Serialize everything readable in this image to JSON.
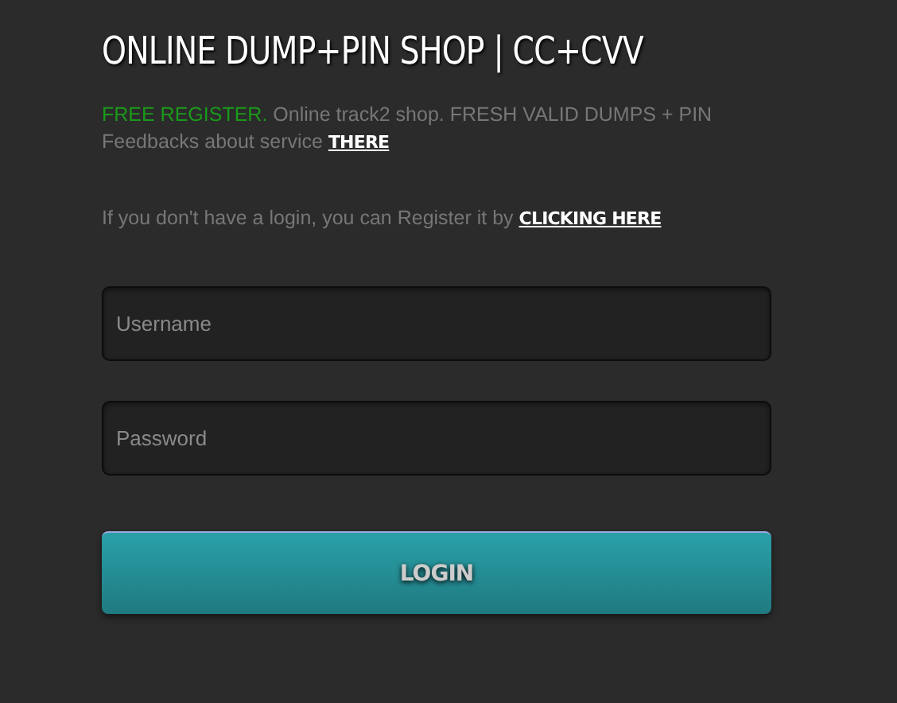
{
  "title": "ONLINE DUMP+PIN SHOP | CC+CVV",
  "intro": {
    "highlight": "FREE REGISTER.",
    "text": "Online track2 shop. FRESH VALID DUMPS + PIN",
    "feedback": "Feedbacks about service",
    "feedback_link": "THERE"
  },
  "register": {
    "text": "If you don't have a login, you can Register it by",
    "link": "CLICKING HERE"
  },
  "fields": [
    {
      "placeholder": "Username"
    },
    {
      "placeholder": "Password"
    }
  ],
  "login_button": "LOGIN"
}
